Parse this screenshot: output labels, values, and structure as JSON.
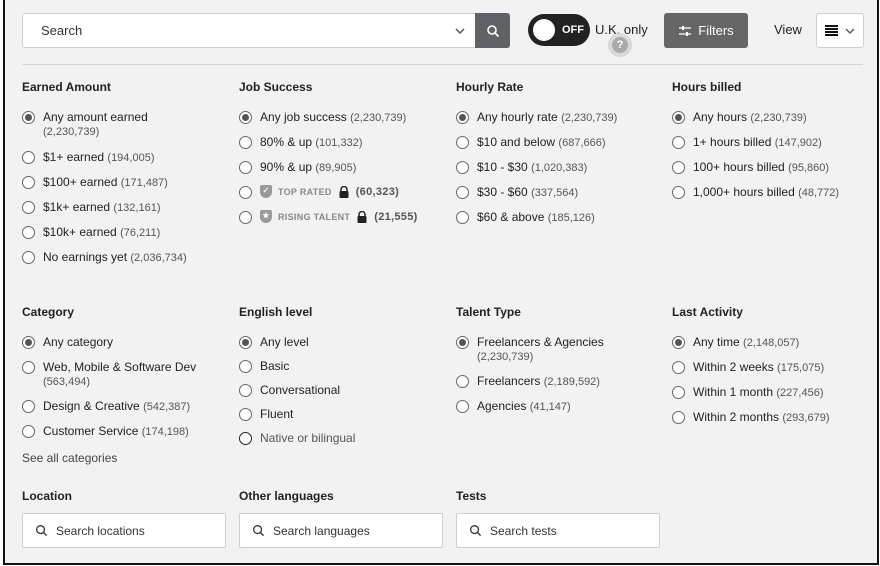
{
  "topbar": {
    "search_placeholder": "Search",
    "toggle_state": "OFF",
    "uk_only_label": "U.K. only",
    "help_label": "?",
    "filters_label": "Filters",
    "view_label": "View"
  },
  "earned_amount": {
    "heading": "Earned Amount",
    "options": [
      {
        "label": "Any amount earned",
        "count": "(2,230,739)",
        "selected": true
      },
      {
        "label": "$1+ earned",
        "count": "(194,005)",
        "selected": false
      },
      {
        "label": "$100+ earned",
        "count": "(171,487)",
        "selected": false
      },
      {
        "label": "$1k+ earned",
        "count": "(132,161)",
        "selected": false
      },
      {
        "label": "$10k+ earned",
        "count": "(76,211)",
        "selected": false
      },
      {
        "label": "No earnings yet",
        "count": "(2,036,734)",
        "selected": false
      }
    ]
  },
  "job_success": {
    "heading": "Job Success",
    "options": [
      {
        "label": "Any job success",
        "count": "(2,230,739)",
        "selected": true
      },
      {
        "label": "80% & up",
        "count": "(101,332)",
        "selected": false
      },
      {
        "label": "90% & up",
        "count": "(89,905)",
        "selected": false
      },
      {
        "label": "TOP RATED",
        "count": "(60,323)",
        "selected": false
      },
      {
        "label": "RISING TALENT",
        "count": "(21,555)",
        "selected": false
      }
    ]
  },
  "hourly_rate": {
    "heading": "Hourly Rate",
    "options": [
      {
        "label": "Any hourly rate",
        "count": "(2,230,739)",
        "selected": true
      },
      {
        "label": "$10 and below",
        "count": "(687,666)",
        "selected": false
      },
      {
        "label": "$10 - $30",
        "count": "(1,020,383)",
        "selected": false
      },
      {
        "label": "$30 - $60",
        "count": "(337,564)",
        "selected": false
      },
      {
        "label": "$60 & above",
        "count": "(185,126)",
        "selected": false
      }
    ]
  },
  "hours_billed": {
    "heading": "Hours billed",
    "options": [
      {
        "label": "Any hours",
        "count": "(2,230,739)",
        "selected": true
      },
      {
        "label": "1+ hours billed",
        "count": "(147,902)",
        "selected": false
      },
      {
        "label": "100+ hours billed",
        "count": "(95,860)",
        "selected": false
      },
      {
        "label": "1,000+ hours billed",
        "count": "(48,772)",
        "selected": false
      }
    ]
  },
  "category": {
    "heading": "Category",
    "options": [
      {
        "label": "Any category",
        "count": "",
        "selected": true
      },
      {
        "label": "Web, Mobile & Software Dev",
        "count": "(563,494)",
        "selected": false
      },
      {
        "label": "Design & Creative",
        "count": "(542,387)",
        "selected": false
      },
      {
        "label": "Customer Service",
        "count": "(174,198)",
        "selected": false
      }
    ],
    "see_all": "See all categories"
  },
  "english_level": {
    "heading": "English level",
    "options": [
      {
        "label": "Any level",
        "selected": true
      },
      {
        "label": "Basic",
        "selected": false
      },
      {
        "label": "Conversational",
        "selected": false
      },
      {
        "label": "Fluent",
        "selected": false
      },
      {
        "label": "Native or bilingual",
        "selected": false
      }
    ]
  },
  "talent_type": {
    "heading": "Talent Type",
    "options": [
      {
        "label": "Freelancers & Agencies",
        "count": "(2,230,739)",
        "selected": true
      },
      {
        "label": "Freelancers",
        "count": "(2,189,592)",
        "selected": false
      },
      {
        "label": "Agencies",
        "count": "(41,147)",
        "selected": false
      }
    ]
  },
  "last_activity": {
    "heading": "Last Activity",
    "options": [
      {
        "label": "Any time",
        "count": "(2,148,057)",
        "selected": true
      },
      {
        "label": "Within 2 weeks",
        "count": "(175,075)",
        "selected": false
      },
      {
        "label": "Within 1 month",
        "count": "(227,456)",
        "selected": false
      },
      {
        "label": "Within 2 months",
        "count": "(293,679)",
        "selected": false
      }
    ]
  },
  "location": {
    "heading": "Location",
    "placeholder": "Search locations"
  },
  "other_languages": {
    "heading": "Other languages",
    "placeholder": "Search languages"
  },
  "tests": {
    "heading": "Tests",
    "placeholder": "Search tests"
  }
}
